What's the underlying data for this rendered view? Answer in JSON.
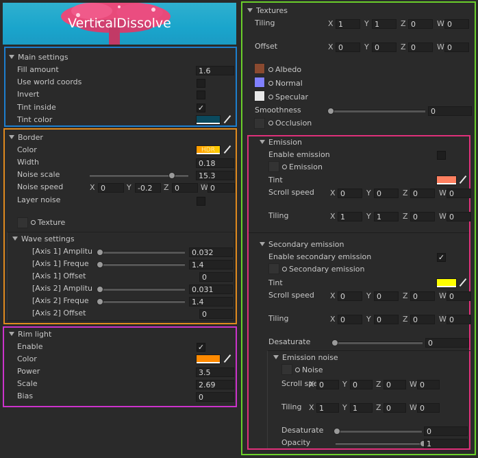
{
  "title": "VerticalDissolve",
  "main": {
    "header": "Main settings",
    "fill_amount_label": "Fill amount",
    "fill_amount": "1.6",
    "use_world_label": "Use world coords",
    "invert_label": "Invert",
    "tint_inside_label": "Tint inside",
    "tint_color_label": "Tint color",
    "tint_color": "#0b4a5e"
  },
  "border": {
    "header": "Border",
    "color_label": "Color",
    "color_hdr": "HDR",
    "width_label": "Width",
    "width": "0.18",
    "noise_scale_label": "Noise scale",
    "noise_scale": "15.3",
    "noise_scale_frac": 0.82,
    "noise_speed_label": "Noise speed",
    "noise_speed": {
      "x": "0",
      "y": "-0.2",
      "z": "0",
      "w": "0"
    },
    "layer_noise_label": "Layer noise",
    "texture_label": "Texture",
    "wave": {
      "header": "Wave settings",
      "rows": [
        {
          "label": "[Axis 1] Amplitu",
          "value": "0.032",
          "slider": true,
          "frac": 0.0
        },
        {
          "label": "[Axis 1] Freque",
          "value": "1.4",
          "slider": true,
          "frac": 0.0
        },
        {
          "label": "[Axis 1] Offset",
          "value": "0",
          "slider": false
        },
        {
          "label": "[Axis 2] Amplitu",
          "value": "0.031",
          "slider": true,
          "frac": 0.0
        },
        {
          "label": "[Axis 2] Freque",
          "value": "1.4",
          "slider": true,
          "frac": 0.0
        },
        {
          "label": "[Axis 2] Offset",
          "value": "0",
          "slider": false
        }
      ]
    }
  },
  "rim": {
    "header": "Rim light",
    "enable_label": "Enable",
    "color_label": "Color",
    "color": "#ff8a00",
    "power_label": "Power",
    "power": "3.5",
    "scale_label": "Scale",
    "scale": "2.69",
    "bias_label": "Bias",
    "bias": "0"
  },
  "textures": {
    "header": "Textures",
    "tiling_label": "Tiling",
    "tiling": {
      "x": "1",
      "y": "1",
      "z": "0",
      "w": "0"
    },
    "offset_label": "Offset",
    "offset": {
      "x": "0",
      "y": "0",
      "z": "0",
      "w": "0"
    },
    "albedo_label": "Albedo",
    "albedo_color": "#8a4a30",
    "normal_label": "Normal",
    "normal_color": "#8080ff",
    "specular_label": "Specular",
    "specular_color": "#e8e8e8",
    "smoothness_label": "Smoothness",
    "smoothness": "0",
    "smoothness_frac": 0.0,
    "occlusion_label": "Occlusion"
  },
  "emission": {
    "header": "Emission",
    "enable_label": "Enable emission",
    "emission_tex_label": "Emission",
    "tint_label": "Tint",
    "tint_color": "#ff8060",
    "scroll_label": "Scroll speed",
    "scroll": {
      "x": "0",
      "y": "0",
      "z": "0",
      "w": "0"
    },
    "tiling_label": "Tiling",
    "tiling": {
      "x": "1",
      "y": "1",
      "z": "0",
      "w": "0"
    }
  },
  "secondary": {
    "header": "Secondary emission",
    "enable_label": "Enable secondary emission",
    "tex_label": "Secondary emission",
    "tint_label": "Tint",
    "tint_color": "#ffff00",
    "scroll_label": "Scroll speed",
    "scroll": {
      "x": "0",
      "y": "0",
      "z": "0",
      "w": "0"
    },
    "tiling_label": "Tiling",
    "tiling": {
      "x": "0",
      "y": "0",
      "z": "0",
      "w": "0"
    },
    "desaturate_label": "Desaturate",
    "desaturate": "0",
    "desaturate_frac": 0.0
  },
  "noise": {
    "header": "Emission noise",
    "tex_label": "Noise",
    "scroll_label": "Scroll speed",
    "scroll": {
      "x": "0",
      "y": "0",
      "z": "0",
      "w": "0"
    },
    "tiling_label": "Tiling",
    "tiling": {
      "x": "1",
      "y": "1",
      "z": "0",
      "w": "0"
    },
    "desaturate_label": "Desaturate",
    "desaturate": "0",
    "desaturate_frac": 0.0,
    "opacity_label": "Opacity",
    "opacity": "1",
    "opacity_frac": 1.0
  },
  "axis_letters": {
    "x": "X",
    "y": "Y",
    "z": "Z",
    "w": "W"
  },
  "colors": {
    "blue": "#1d7fd0",
    "orange": "#e08a1e",
    "magenta": "#cc33cc",
    "green": "#6bd02a",
    "pink": "#e0307a"
  }
}
